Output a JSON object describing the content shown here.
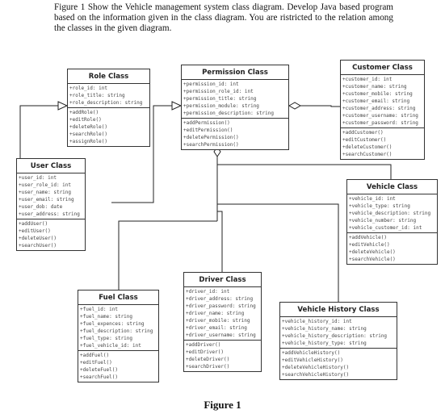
{
  "caption": "Figure 1 Show the Vehicle  management system class diagram. Develop Java based program based on the information given in the class diagram. You are ristricted to the relation among the classes in the given diagram.",
  "figure_label": "Figure 1",
  "classes": {
    "role": {
      "title": "Role Class",
      "attributes": [
        "+role_id: int",
        "+role_title: string",
        "+role_description: string"
      ],
      "methods": [
        "+addRole()",
        "+editRole()",
        "+deleteRole()",
        "+searchRole()",
        "+assignRole()"
      ]
    },
    "permission": {
      "title": "Permission Class",
      "attributes": [
        "+permission_id: int",
        "+permission_role_id: int",
        "+permission_title: string",
        "+permission_module: string",
        "+permission_description: string"
      ],
      "methods": [
        "+addPermission()",
        "+editPermission()",
        "+deletePermission()",
        "+searchPermission()"
      ]
    },
    "customer": {
      "title": "Customer Class",
      "attributes": [
        "+customer_id: int",
        "+customer_name: string",
        "+customer_mobile: string",
        "+customer_email: string",
        "+customer_address: string",
        "+customer_username: string",
        "+customer_password: string"
      ],
      "methods": [
        "+addCustomer()",
        "+editCustomer()",
        "+deleteCustomer()",
        "+searchCustomer()"
      ]
    },
    "user": {
      "title": "User Class",
      "attributes": [
        "+user_id: int",
        "+user_role_id: int",
        "+user_name: string",
        "+user_email: string",
        "+user_dob: date",
        "+user_address: string"
      ],
      "methods": [
        "+addUser()",
        "+editUser()",
        "+deleteUser()",
        "+searchUser()"
      ]
    },
    "vehicle": {
      "title": "Vehicle Class",
      "attributes": [
        "+vehicle_id: int",
        "+vehicle_type: string",
        "+vehicle_description: string",
        "+vehicle_number: string",
        "+vehicle_customer_id: int"
      ],
      "methods": [
        "+addVehicle()",
        "+editVehicle()",
        "+deleteVehicle()",
        "+searchVehicle()"
      ]
    },
    "driver": {
      "title": "Driver Class",
      "attributes": [
        "+driver_id: int",
        "+driver_address: string",
        "+driver_password: string",
        "+driver_name: string",
        "+driver_mobile: string",
        "+driver_email: string",
        "+driver_username: string"
      ],
      "methods": [
        "+addDriver()",
        "+editDriver()",
        "+deleteDriver()",
        "+searchDriver()"
      ]
    },
    "fuel": {
      "title": "Fuel Class",
      "attributes": [
        "+fuel_id: int",
        "+fuel_name: string",
        "+fuel_expences: string",
        "+fuel_description: string",
        "+fuel_type: string",
        "+fuel_vehicle_id: int"
      ],
      "methods": [
        "+addFuel()",
        "+editFuel()",
        "+deleteFuel()",
        "+searchFuel()"
      ]
    },
    "vehicle_history": {
      "title": "Vehicle History Class",
      "attributes": [
        "+vehicle_history_id: int",
        "+vehicle_history_name: string",
        "+vehicle_history_description: string",
        "+vehicle_history_type: string"
      ],
      "methods": [
        "+addVehicleHistory()",
        "+editVehicleHistory()",
        "+deleteVehicleHistory()",
        "+searchVehicleHistory()"
      ]
    }
  },
  "relations": [
    {
      "from": "user",
      "to": "role",
      "type": "generalization"
    },
    {
      "from": "user",
      "to": "permission",
      "type": "generalization"
    },
    {
      "from": "customer",
      "to": "permission",
      "type": "aggregation"
    },
    {
      "from": "vehicle",
      "to": "permission",
      "type": "aggregation"
    },
    {
      "from": "driver",
      "to": "permission",
      "type": "aggregation"
    },
    {
      "from": "fuel",
      "to": "permission",
      "type": "aggregation"
    },
    {
      "from": "vehicle_history",
      "to": "permission",
      "type": "aggregation"
    }
  ]
}
